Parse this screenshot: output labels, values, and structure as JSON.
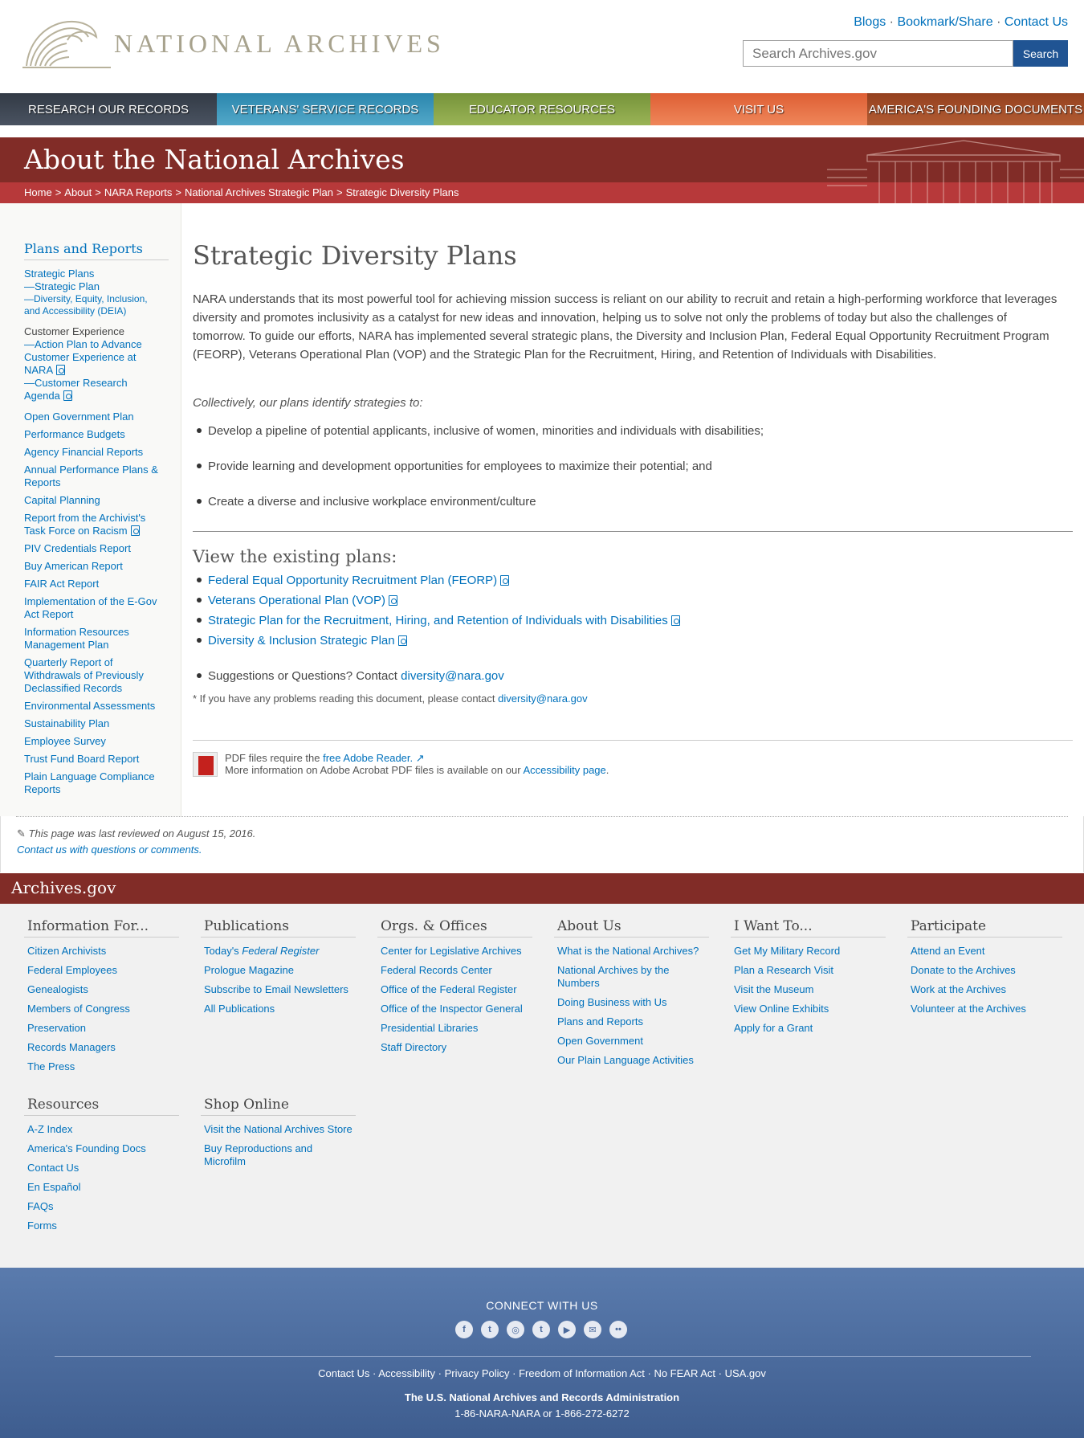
{
  "header": {
    "logo_text": "NATIONAL ARCHIVES",
    "util_links": [
      "Blogs",
      "Bookmark/Share",
      "Contact Us"
    ],
    "search_placeholder": "Search Archives.gov",
    "search_button": "Search"
  },
  "nav": [
    {
      "label": "Research Our Records",
      "color": "#323a45"
    },
    {
      "label": "Veterans' Service Records",
      "color": "#2e8fb4"
    },
    {
      "label": "Educator Resources",
      "color": "#7d9a3a"
    },
    {
      "label": "Visit Us",
      "color": "#e3653a"
    },
    {
      "label": "America's Founding Documents",
      "color": "#9a4522"
    }
  ],
  "banner": {
    "title": "About the National Archives",
    "breadcrumb": [
      "Home",
      "About",
      "NARA Reports",
      "National Archives Strategic Plan",
      "Strategic Diversity Plans"
    ]
  },
  "sidebar": {
    "heading": "Plans and Reports",
    "strategic_plans": "Strategic Plans",
    "strategic_plan_sub": "—Strategic Plan",
    "deia_sub": "—Diversity, Equity, Inclusion, and Accessibility (DEIA)",
    "customer_experience": "Customer Experience",
    "cx_action_plan": "—Action Plan to Advance Customer Experience at NARA",
    "cx_research": "—Customer Research Agenda",
    "items": [
      "Open Government Plan",
      "Performance Budgets",
      "Agency Financial Reports",
      "Annual Performance Plans & Reports",
      "Capital Planning",
      "Report from the Archivist's Task Force on Racism",
      "PIV Credentials Report",
      "Buy American Report",
      "FAIR Act Report",
      "Implementation of the E-Gov Act Report",
      "Information Resources Management Plan",
      "Quarterly Report of Withdrawals of Previously Declassified Records",
      "Environmental Assessments",
      "Sustainability Plan",
      "Employee Survey",
      "Trust Fund Board Report",
      "Plain Language Compliance Reports"
    ]
  },
  "main": {
    "title": "Strategic Diversity Plans",
    "intro": "NARA understands that its most powerful tool for achieving mission success is reliant on our ability to recruit and retain a high-performing workforce that leverages diversity and promotes inclusivity as a catalyst for new ideas and innovation, helping us to solve not only the problems of today but also the challenges of tomorrow. To guide our efforts, NARA has implemented several strategic plans, the Diversity and Inclusion Plan, Federal Equal Opportunity Recruitment Program (FEORP), Veterans Operational Plan (VOP) and the Strategic Plan for the Recruitment, Hiring, and Retention of Individuals with Disabilities.",
    "collectively": "Collectively, our plans identify strategies to:",
    "strategies": [
      "Develop a pipeline of potential applicants, inclusive of women, minorities and individuals with disabilities;",
      "Provide learning and development opportunities for employees to maximize their potential; and",
      "Create a diverse and inclusive workplace environment/culture"
    ],
    "view_title": "View the existing plans:",
    "plans": [
      "Federal Equal Opportunity Recruitment Plan (FEORP)",
      "Veterans Operational Plan (VOP)",
      "Strategic Plan for the Recruitment, Hiring, and Retention of Individuals with Disabilities",
      "Diversity & Inclusion Strategic Plan"
    ],
    "suggestions_text": "Suggestions or Questions? Contact ",
    "email": "diversity@nara.gov",
    "note_text": "* If you have any problems reading this document, please contact ",
    "pdf_line1_text": "PDF files require the ",
    "pdf_reader_link": "free Adobe Reader.",
    "pdf_line2_text": "More information on Adobe Acrobat PDF files is available on our ",
    "accessibility_link": "Accessibility page",
    "period": "."
  },
  "review": {
    "reviewed": "This page was last reviewed on August 15, 2016.",
    "contact": "Contact us with questions or comments."
  },
  "footer": {
    "bar_title": "Archives.gov",
    "columns": [
      {
        "title": "Information For...",
        "items": [
          "Citizen Archivists",
          "Federal Employees",
          "Genealogists",
          "Members of Congress",
          "Preservation",
          "Records Managers",
          "The Press"
        ]
      },
      {
        "title": "Publications",
        "items": [
          "Today's Federal Register",
          "Prologue Magazine",
          "Subscribe to Email Newsletters",
          "All Publications"
        ]
      },
      {
        "title": "Orgs. & Offices",
        "items": [
          "Center for Legislative Archives",
          "Federal Records Center",
          "Office of the Federal Register",
          "Office of the Inspector General",
          "Presidential Libraries",
          "Staff Directory"
        ]
      },
      {
        "title": "About Us",
        "items": [
          "What is the National Archives?",
          "National Archives by the Numbers",
          "Doing Business with Us",
          "Plans and Reports",
          "Open Government",
          "Our Plain Language Activities"
        ]
      },
      {
        "title": "I Want To...",
        "items": [
          "Get My Military Record",
          "Plan a Research Visit",
          "Visit the Museum",
          "View Online Exhibits",
          "Apply for a Grant"
        ]
      },
      {
        "title": "Participate",
        "items": [
          "Attend an Event",
          "Donate to the Archives",
          "Work at the Archives",
          "Volunteer at the Archives"
        ]
      },
      {
        "title": "Resources",
        "items": [
          "A-Z Index",
          "America's Founding Docs",
          "Contact Us",
          "En Español",
          "FAQs",
          "Forms"
        ]
      },
      {
        "title": "Shop Online",
        "items": [
          "Visit the National Archives Store",
          "Buy Reproductions and Microfilm"
        ]
      }
    ],
    "connect_title": "CONNECT WITH US",
    "social": [
      {
        "name": "facebook-icon",
        "glyph": "f"
      },
      {
        "name": "twitter-icon",
        "glyph": "t"
      },
      {
        "name": "instagram-icon",
        "glyph": "◎"
      },
      {
        "name": "tumblr-icon",
        "glyph": "t"
      },
      {
        "name": "youtube-icon",
        "glyph": "▶"
      },
      {
        "name": "blog-icon",
        "glyph": "✉"
      },
      {
        "name": "flickr-icon",
        "glyph": "••"
      }
    ],
    "legal": [
      "Contact Us",
      "Accessibility",
      "Privacy Policy",
      "Freedom of Information Act",
      "No FEAR Act",
      "USA.gov"
    ],
    "agency": "The U.S. National Archives and Records Administration",
    "phone": "1-86-NARA-NARA or 1-866-272-6272"
  }
}
